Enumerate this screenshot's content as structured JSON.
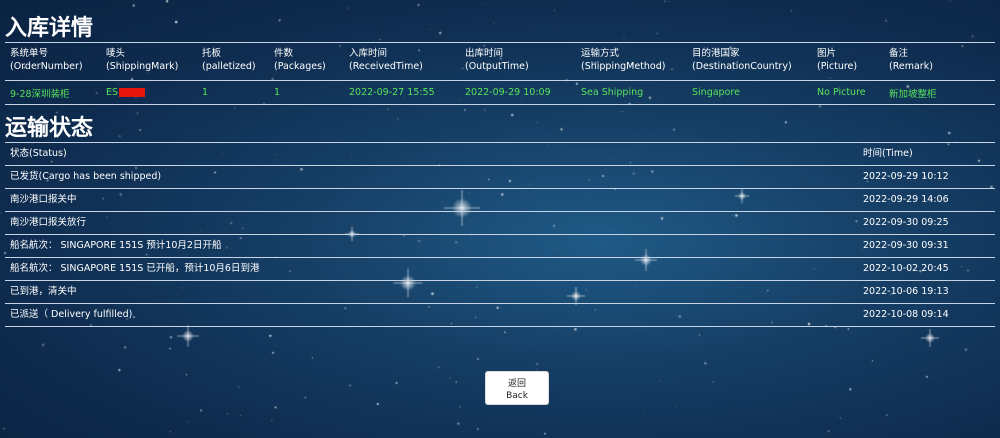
{
  "warehouse": {
    "title": "入库详情",
    "columns": [
      {
        "cn": "系统单号",
        "en": "(OrderNumber)"
      },
      {
        "cn": "唛头",
        "en": "(ShippingMark)"
      },
      {
        "cn": "托板",
        "en": "(palletized)"
      },
      {
        "cn": "件数",
        "en": "(Packages)"
      },
      {
        "cn": "入库时间",
        "en": "(ReceivedTime)"
      },
      {
        "cn": "出库时间",
        "en": "(OutputTime)"
      },
      {
        "cn": "运输方式",
        "en": "(ShippingMethod)"
      },
      {
        "cn": "目的港国家",
        "en": "(DestinationCountry)"
      },
      {
        "cn": "图片",
        "en": "(Picture)"
      },
      {
        "cn": "备注",
        "en": "(Remark)"
      }
    ],
    "row": {
      "order_number": "9-28深圳装柜",
      "shipping_mark": "ES",
      "palletized": "1",
      "packages": "1",
      "received_time": "2022-09-27 15:55",
      "output_time": "2022-09-29 10:09",
      "shipping_method": "Sea Shipping",
      "destination_country": "Singapore",
      "picture": "No Picture",
      "remark": "新加坡整柜"
    }
  },
  "transport": {
    "title": "运输状态",
    "status_header": "状态(Status)",
    "time_header": "时间(Time)",
    "events": [
      {
        "status": "已发货(Cargo has been shipped)",
        "time": "2022-09-29 10:12"
      },
      {
        "status": "南沙港口报关中",
        "time": "2022-09-29 14:06"
      },
      {
        "status": "南沙港口报关放行",
        "time": "2022-09-30 09:25"
      },
      {
        "status": "船名航次： SINGAPORE 151S 预计10月2日开船",
        "time": "2022-09-30 09:31"
      },
      {
        "status": "船名航次： SINGAPORE 151S 已开船，预计10月6日到港",
        "time": "2022-10-02 20:45"
      },
      {
        "status": "已到港，清关中",
        "time": "2022-10-06 19:13"
      },
      {
        "status": "已派送（ Delivery fulfilled)",
        "time": "2022-10-08 09:14"
      }
    ]
  },
  "back_button": {
    "cn": "返回",
    "en": "Back"
  },
  "colors": {
    "data_green": "#56e35c",
    "redaction": "#e8150f",
    "background": "#163f66"
  }
}
